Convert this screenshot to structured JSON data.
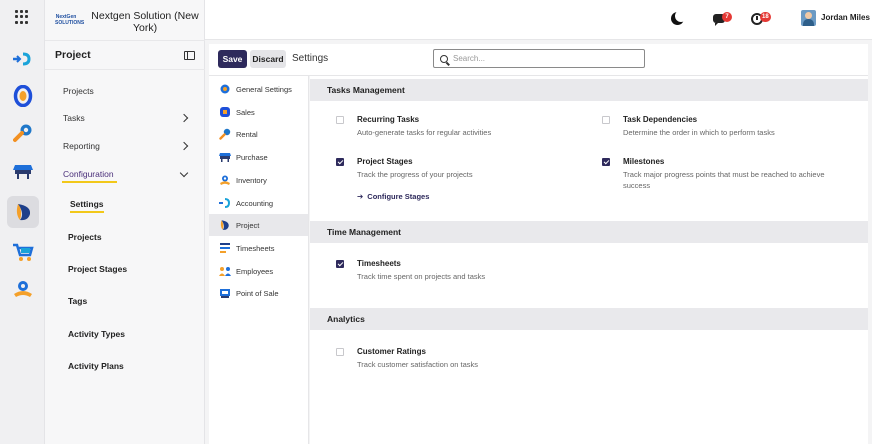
{
  "rail": {
    "apps": [
      {
        "name": "rail-app-accounting",
        "icon": "accounting-icon"
      },
      {
        "name": "rail-app-timesheets",
        "icon": "timesheets-icon"
      },
      {
        "name": "rail-app-tools",
        "icon": "wrench-icon"
      },
      {
        "name": "rail-app-point-of-sale",
        "icon": "point-of-sale-icon"
      },
      {
        "name": "rail-app-project",
        "icon": "project-icon"
      },
      {
        "name": "rail-app-purchase",
        "icon": "cart-icon"
      },
      {
        "name": "rail-app-employees",
        "icon": "employees-icon"
      }
    ]
  },
  "sidebar": {
    "company_logo": "NextGen SOLUTIONS",
    "company_name": "Nextgen Solution (New York)",
    "title": "Project",
    "menu": [
      {
        "label": "Projects"
      },
      {
        "label": "Tasks"
      },
      {
        "label": "Reporting"
      },
      {
        "label": "Configuration"
      }
    ],
    "submenu": [
      {
        "label": "Settings"
      },
      {
        "label": "Projects"
      },
      {
        "label": "Project Stages"
      },
      {
        "label": "Tags"
      },
      {
        "label": "Activity Types"
      },
      {
        "label": "Activity Plans"
      }
    ]
  },
  "topbar": {
    "messages_count": "7",
    "activities_count": "18",
    "user_name": "Jordan Miles"
  },
  "controls": {
    "save_label": "Save",
    "discard_label": "Discard",
    "breadcrumb": "Settings",
    "search_placeholder": "Search..."
  },
  "apps": [
    {
      "label": "General Settings"
    },
    {
      "label": "Sales"
    },
    {
      "label": "Rental"
    },
    {
      "label": "Purchase"
    },
    {
      "label": "Inventory"
    },
    {
      "label": "Accounting"
    },
    {
      "label": "Project"
    },
    {
      "label": "Timesheets"
    },
    {
      "label": "Employees"
    },
    {
      "label": "Point of Sale"
    }
  ],
  "sections": {
    "tasks_management": {
      "title": "Tasks Management",
      "recurring_tasks": {
        "title": "Recurring Tasks",
        "desc": "Auto-generate tasks for regular activities",
        "checked": false
      },
      "task_dependencies": {
        "title": "Task Dependencies",
        "desc": "Determine the order in which to perform tasks",
        "checked": false
      },
      "project_stages": {
        "title": "Project Stages",
        "desc": "Track the progress of your projects",
        "link": "Configure Stages",
        "checked": true
      },
      "milestones": {
        "title": "Milestones",
        "desc": "Track major progress points that must be reached to achieve success",
        "checked": true
      }
    },
    "time_management": {
      "title": "Time Management",
      "timesheets": {
        "title": "Timesheets",
        "desc": "Track time spent on projects and tasks",
        "checked": true
      }
    },
    "analytics": {
      "title": "Analytics",
      "customer_ratings": {
        "title": "Customer Ratings",
        "desc": "Track customer satisfaction on tasks",
        "checked": false
      }
    }
  }
}
